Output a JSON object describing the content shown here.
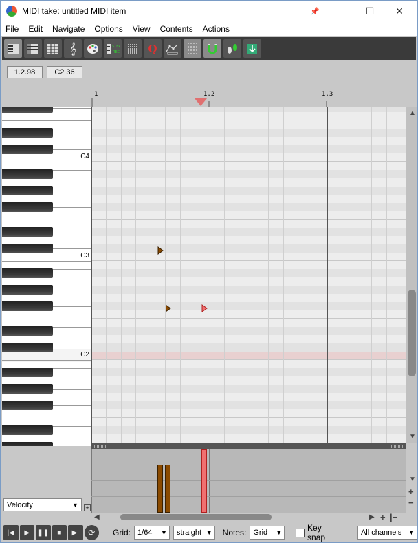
{
  "window": {
    "title": "MIDI take: untitled MIDI item",
    "minimize": "—",
    "maximize": "☐",
    "close": "✕",
    "pin": "📌"
  },
  "menu": [
    "File",
    "Edit",
    "Navigate",
    "Options",
    "View",
    "Contents",
    "Actions"
  ],
  "toolbar": {
    "icons": [
      "piano-roll-icon",
      "named-notes-icon",
      "drum-grid-icon",
      "notation-icon",
      "color-palette-icon",
      "step-input-icon",
      "event-list-icon",
      "quantize-icon",
      "cc-curve-icon",
      "grid-snap-icon",
      "magnet-icon",
      "swing-feet-icon",
      "midi-import-icon"
    ]
  },
  "position": {
    "time": "1.2.98",
    "note": "C2  36"
  },
  "ruler": {
    "labels": [
      "1",
      "1.2",
      "1.3"
    ]
  },
  "piano": {
    "labels": [
      "C4",
      "C3",
      "C2"
    ]
  },
  "lane": {
    "selector": "Velocity"
  },
  "bottom": {
    "grid_label": "Grid:",
    "grid_value": "1/64",
    "grid_type": "straight",
    "notes_label": "Notes:",
    "notes_value": "Grid",
    "keysnap_label": "Key snap",
    "channels": "All channels"
  },
  "colors": {
    "note": "#8a4a00",
    "selected_note": "#f07070",
    "playhead": "#d02020"
  }
}
